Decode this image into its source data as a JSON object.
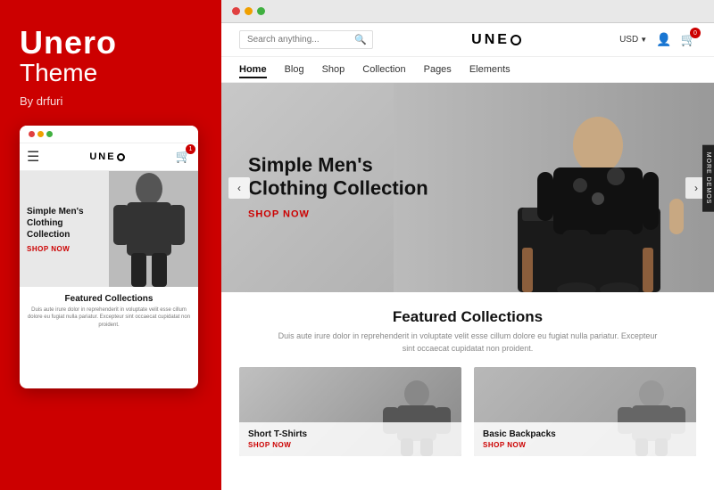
{
  "left": {
    "brand_name": "Unero",
    "brand_subtitle": "Theme",
    "by_line": "By drfuri",
    "dots": [
      "#e04040",
      "#f0a000",
      "#40b040"
    ],
    "mobile_logo": "UNERO",
    "mobile_cart_count": "1",
    "mobile_hero_title": "Simple Men's Clothing Collection",
    "mobile_shop_now": "Shop Now",
    "mobile_collections_title": "Featured Collections",
    "mobile_collections_desc": "Duis aute irure dolor in reprehenderit in voluptate velit esse cillum dolore eu fugiat nulla pariatur. Excepteur sint occaecat cupidatat non proident."
  },
  "browser": {
    "dots": [
      "#e04040",
      "#f0a000",
      "#40b040"
    ],
    "search_placeholder": "Search anything...",
    "logo": "UNERO",
    "currency": "USD",
    "cart_count": "0",
    "nav_items": [
      "Home",
      "Blog",
      "Shop",
      "Collection",
      "Pages",
      "Elements"
    ],
    "active_nav": "Home",
    "hero_title": "Simple Men's Clothing Collection",
    "hero_shop_now": "Shop Now",
    "more_demos": "MORE DEMOS",
    "featured_title": "Featured Collections",
    "featured_desc": "Duis aute irure dolor in reprehenderit in voluptate velit esse cillum dolore eu fugiat nulla pariatur. Excepteur sint occaecat cupidatat non proident.",
    "collections": [
      {
        "name": "Short T-Shirts",
        "shop_label": "Shop Now"
      },
      {
        "name": "Basic Backpacks",
        "shop_label": "Shop Now"
      }
    ]
  }
}
